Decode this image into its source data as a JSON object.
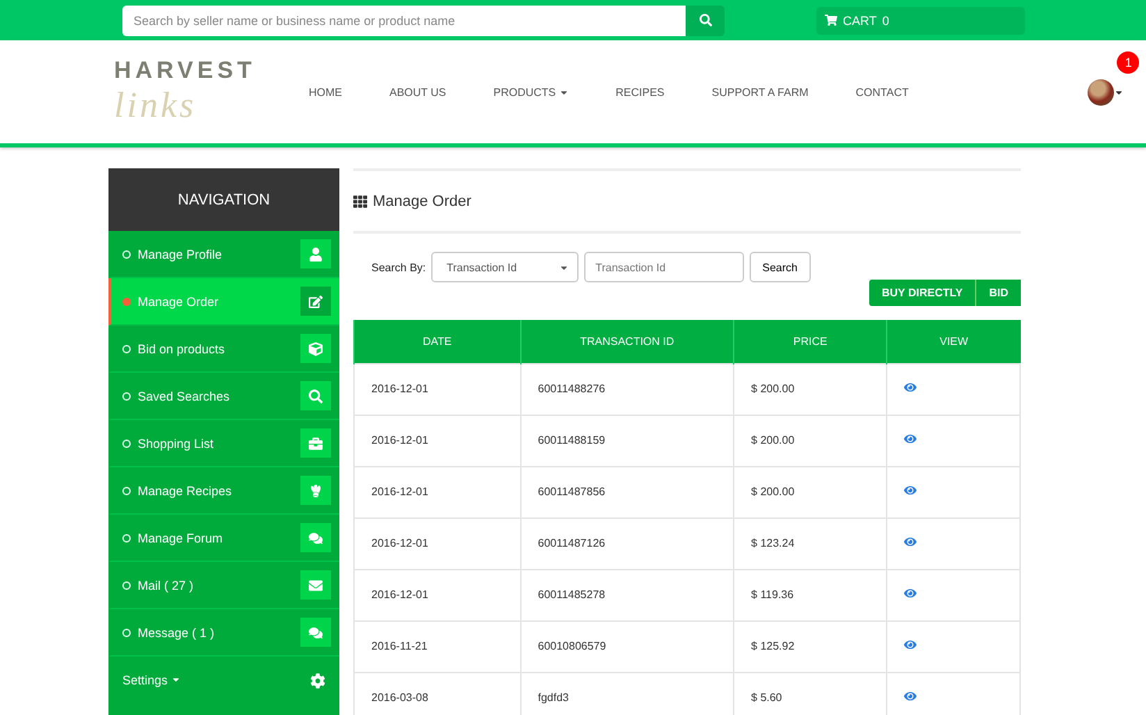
{
  "topbar": {
    "search": {
      "placeholder": "Search by seller name or business name or product name"
    },
    "cart": {
      "label": "CART",
      "count": "0"
    }
  },
  "header": {
    "logo": {
      "top": "HARVEST",
      "bottom": "links"
    },
    "menu": [
      {
        "label": "HOME",
        "dropdown": false
      },
      {
        "label": "ABOUT US",
        "dropdown": false
      },
      {
        "label": "PRODUCTS",
        "dropdown": true
      },
      {
        "label": "RECIPES",
        "dropdown": false
      },
      {
        "label": "SUPPORT A FARM",
        "dropdown": false
      },
      {
        "label": "CONTACT",
        "dropdown": false
      }
    ],
    "notifications": "1"
  },
  "sidebar": {
    "title": "NAVIGATION",
    "items": [
      {
        "label": "Manage Profile",
        "selected": false
      },
      {
        "label": "Manage Order",
        "selected": true
      },
      {
        "label": "Bid on products",
        "selected": false
      },
      {
        "label": "Saved Searches",
        "selected": false
      },
      {
        "label": "Shopping List",
        "selected": false
      },
      {
        "label": "Manage Recipes",
        "selected": false
      },
      {
        "label": "Manage Forum",
        "selected": false
      },
      {
        "label": "Mail ( 27 )",
        "selected": false
      },
      {
        "label": "Message ( 1 )",
        "selected": false
      }
    ],
    "settings": "Settings"
  },
  "main": {
    "title": "Manage Order",
    "search_by_label": "Search By:",
    "search_by_value": "Transaction Id",
    "search_placeholder": "Transaction Id",
    "search_button": "Search",
    "mode_buttons": [
      {
        "label": "BUY DIRECTLY"
      },
      {
        "label": "BID"
      }
    ],
    "table": {
      "columns": [
        "DATE",
        "TRANSACTION ID",
        "PRICE",
        "VIEW"
      ],
      "rows": [
        {
          "date": "2016-12-01",
          "transaction_id": "60011488276",
          "price": "$ 200.00"
        },
        {
          "date": "2016-12-01",
          "transaction_id": "60011488159",
          "price": "$ 200.00"
        },
        {
          "date": "2016-12-01",
          "transaction_id": "60011487856",
          "price": "$ 200.00"
        },
        {
          "date": "2016-12-01",
          "transaction_id": "60011487126",
          "price": "$ 123.24"
        },
        {
          "date": "2016-12-01",
          "transaction_id": "60011485278",
          "price": "$ 119.36"
        },
        {
          "date": "2016-11-21",
          "transaction_id": "60010806579",
          "price": "$ 125.92"
        },
        {
          "date": "2016-03-08",
          "transaction_id": "fgdfd3",
          "price": "$ 5.60"
        }
      ]
    }
  }
}
